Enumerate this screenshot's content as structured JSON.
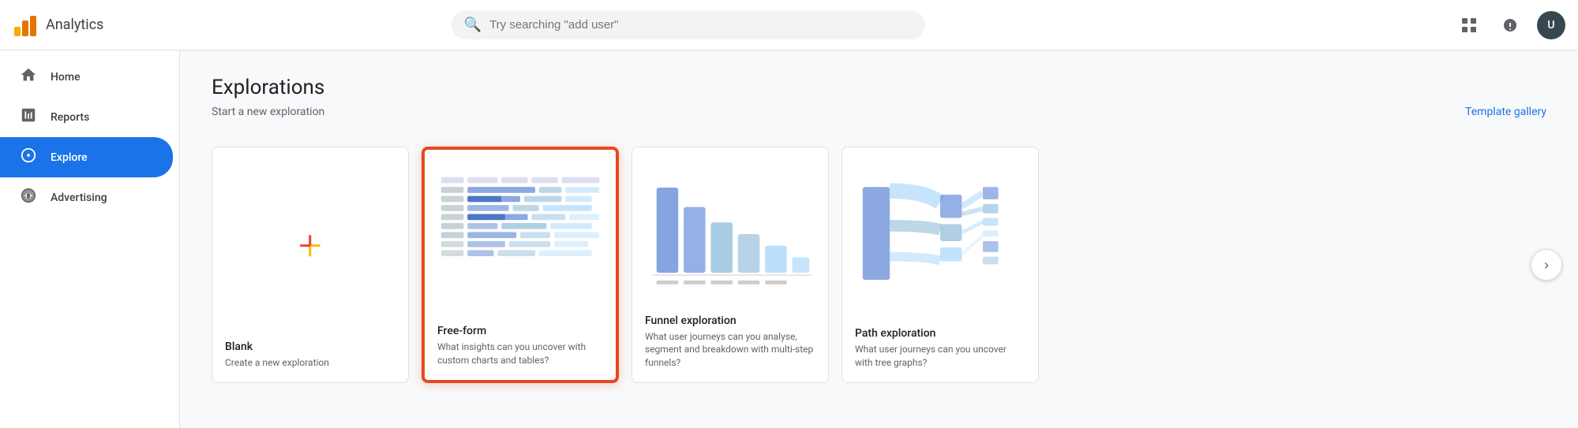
{
  "header": {
    "title": "Analytics",
    "search_placeholder": "Try searching \"add user\"",
    "avatar_initials": "U"
  },
  "sidebar": {
    "items": [
      {
        "id": "home",
        "label": "Home",
        "icon": "⌂",
        "active": false
      },
      {
        "id": "reports",
        "label": "Reports",
        "icon": "📊",
        "active": false
      },
      {
        "id": "explore",
        "label": "Explore",
        "icon": "◎",
        "active": true
      },
      {
        "id": "advertising",
        "label": "Advertising",
        "icon": "◑",
        "active": false
      }
    ]
  },
  "main": {
    "page_title": "Explorations",
    "section_label": "Start a new exploration",
    "template_gallery_label": "Template gallery",
    "cards": [
      {
        "id": "blank",
        "name": "Blank",
        "desc": "Create a new exploration",
        "highlighted": false
      },
      {
        "id": "free-form",
        "name": "Free-form",
        "desc": "What insights can you uncover with custom charts and tables?",
        "highlighted": true
      },
      {
        "id": "funnel",
        "name": "Funnel exploration",
        "desc": "What user journeys can you analyse, segment and breakdown with multi-step funnels?",
        "highlighted": false
      },
      {
        "id": "path",
        "name": "Path exploration",
        "desc": "What user journeys can you uncover with tree graphs?",
        "highlighted": false
      }
    ],
    "next_button_label": "›"
  }
}
